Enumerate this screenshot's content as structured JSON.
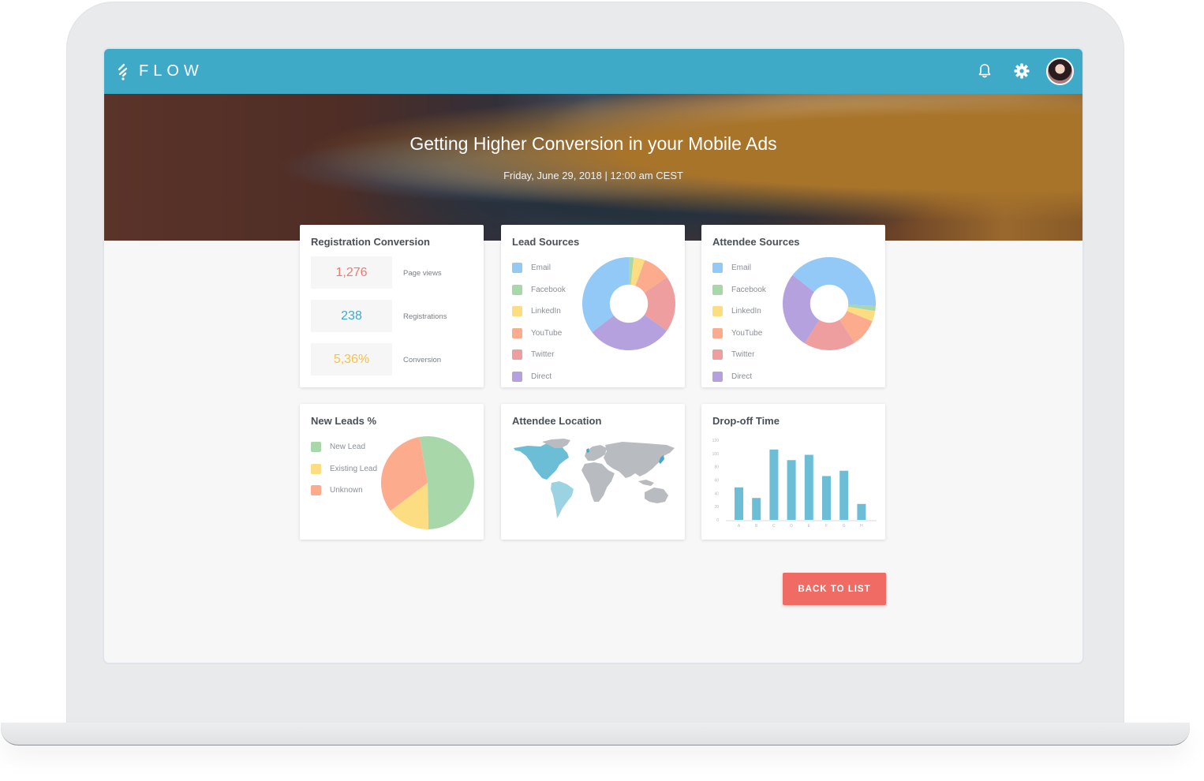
{
  "app": {
    "logo_text": "FLOW",
    "accent_color": "#3eaac8"
  },
  "topbar": {
    "icons": [
      "bell-icon",
      "gear-icon",
      "avatar"
    ]
  },
  "hero": {
    "title": "Getting Higher Conversion in your Mobile Ads",
    "date": "Friday, June 29, 2018 | 12:00 am CEST"
  },
  "registration": {
    "title": "Registration Conversion",
    "stats": [
      {
        "value": "1,276",
        "label": "Page views",
        "color": "#f07a6e"
      },
      {
        "value": "238",
        "label": "Registrations",
        "color": "#3eaac8"
      },
      {
        "value": "5,36%",
        "label": "Conversion",
        "color": "#f7c241"
      }
    ]
  },
  "lead_sources": {
    "title": "Lead Sources"
  },
  "attendee_sources": {
    "title": "Attendee Sources"
  },
  "new_leads": {
    "title": "New Leads %"
  },
  "attendee_location": {
    "title": "Attendee Location",
    "highlighted_regions": [
      "North America",
      "South America",
      "United Kingdom",
      "Japan"
    ]
  },
  "dropoff": {
    "title": "Drop-off Time"
  },
  "actions": {
    "back_label": "BACK TO LIST"
  },
  "chart_data": [
    {
      "id": "lead_sources",
      "type": "pie",
      "donut": true,
      "title": "Lead Sources",
      "start_angle_deg": 0,
      "categories": [
        "Email",
        "Facebook",
        "LinkedIn",
        "YouTube",
        "Twitter",
        "Direct"
      ],
      "colors": [
        "#92c9f6",
        "#a8d8a9",
        "#fddd82",
        "#fdab8d",
        "#ee9e9f",
        "#b5a1de"
      ],
      "values": [
        35.5,
        1.7,
        3.9,
        9.7,
        19.5,
        29.7
      ],
      "slice_order": [
        "Facebook",
        "LinkedIn",
        "YouTube",
        "Twitter",
        "Direct",
        "Email"
      ],
      "legend": "left"
    },
    {
      "id": "attendee_sources",
      "type": "pie",
      "donut": true,
      "title": "Attendee Sources",
      "start_angle_deg": -52,
      "categories": [
        "Email",
        "Facebook",
        "LinkedIn",
        "YouTube",
        "Twitter",
        "Direct"
      ],
      "colors": [
        "#92c9f6",
        "#a8d8a9",
        "#fddd82",
        "#fdab8d",
        "#ee9e9f",
        "#b5a1de"
      ],
      "values": [
        40.3,
        1.7,
        3.6,
        9.7,
        18.0,
        26.7
      ],
      "slice_order": [
        "Email",
        "Facebook",
        "LinkedIn",
        "YouTube",
        "Twitter",
        "Direct"
      ],
      "legend": "left"
    },
    {
      "id": "new_leads",
      "type": "pie",
      "donut": false,
      "title": "New Leads %",
      "start_angle_deg": -10,
      "categories": [
        "New Lead",
        "Existing Lead",
        "Unknown"
      ],
      "colors": [
        "#a8d8a9",
        "#fddd82",
        "#fdab8d"
      ],
      "values": [
        52.5,
        15.0,
        32.5
      ],
      "slice_order": [
        "New Lead",
        "Existing Lead",
        "Unknown"
      ],
      "legend": "left"
    },
    {
      "id": "dropoff",
      "type": "bar",
      "title": "Drop-off Time",
      "categories": [
        "A",
        "B",
        "C",
        "D",
        "E",
        "F",
        "G",
        "H"
      ],
      "values": [
        49,
        33,
        106,
        90,
        98,
        66,
        74,
        24
      ],
      "yticks": [
        0,
        20,
        40,
        60,
        80,
        100,
        120
      ],
      "ylim": [
        0,
        120
      ],
      "color": "#6bbed6",
      "grid": false,
      "xlabel": "",
      "ylabel": ""
    }
  ]
}
